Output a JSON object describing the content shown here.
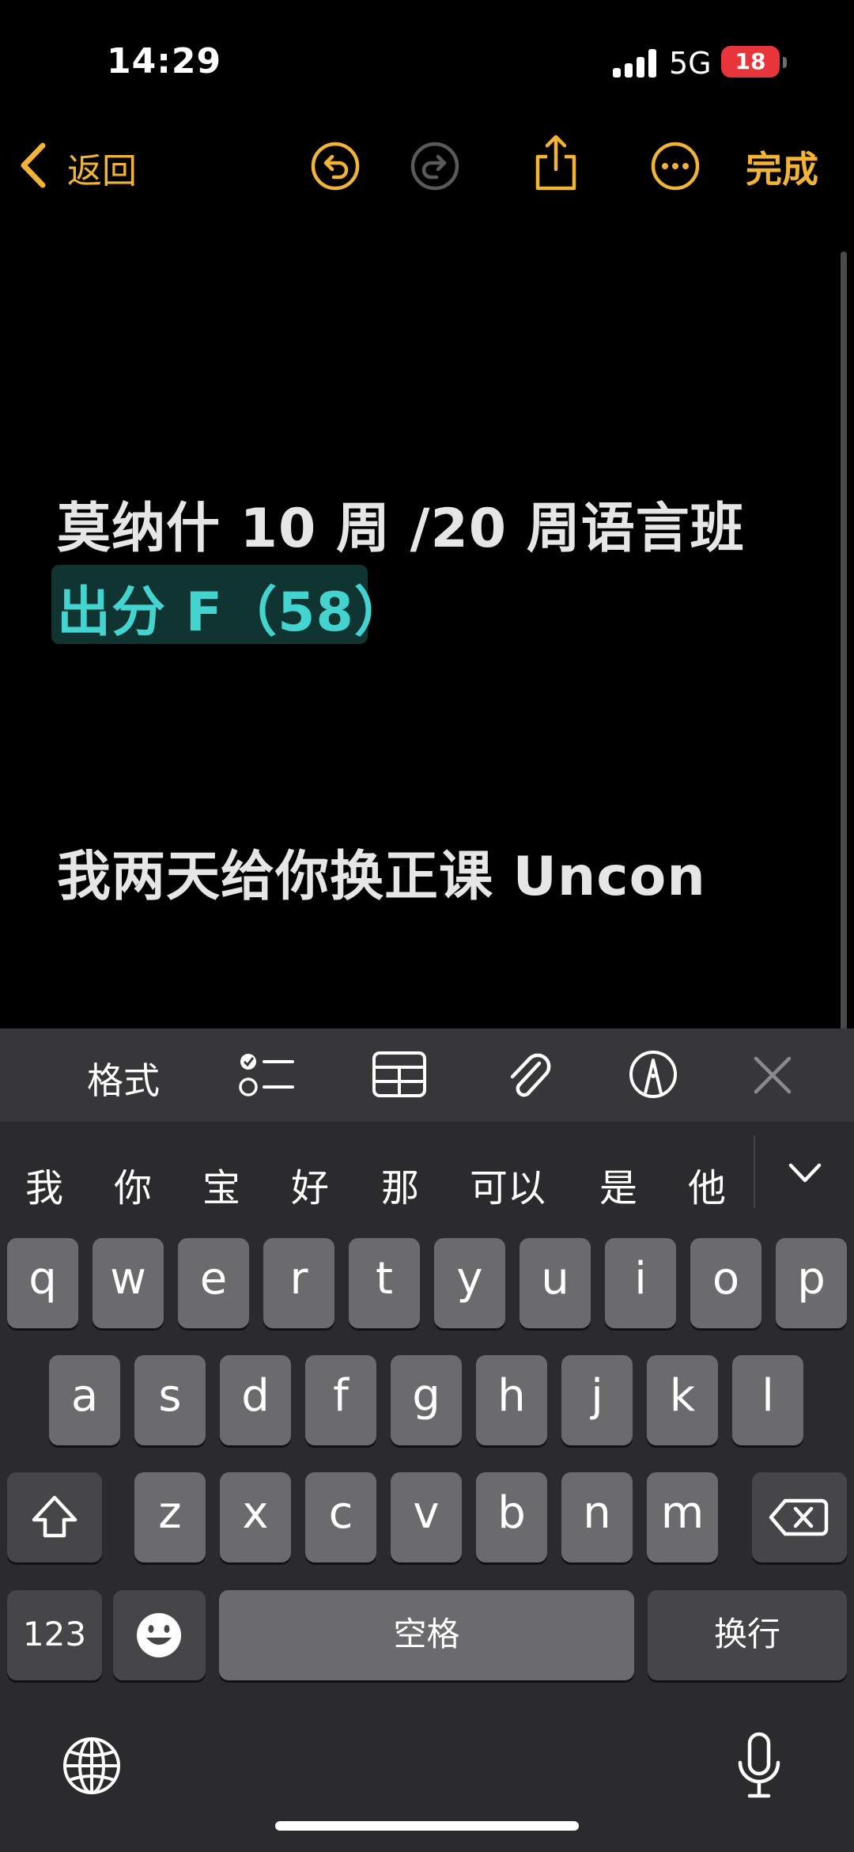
{
  "status_bar": {
    "time": "14:29",
    "network": "5G",
    "battery": "18"
  },
  "nav": {
    "back_label": "返回",
    "done_label": "完成"
  },
  "note": {
    "title": "莫纳什 10 周 /20 周语言班",
    "highlight": "出分 F（58）",
    "body": "我两天给你换正课 Uncon"
  },
  "toolbar": {
    "format_label": "格式"
  },
  "keyboard": {
    "candidates": [
      "我",
      "你",
      "宝",
      "好",
      "那",
      "可以",
      "是",
      "他"
    ],
    "row1": [
      "q",
      "w",
      "e",
      "r",
      "t",
      "y",
      "u",
      "i",
      "o",
      "p"
    ],
    "row2": [
      "a",
      "s",
      "d",
      "f",
      "g",
      "h",
      "j",
      "k",
      "l"
    ],
    "row3": [
      "z",
      "x",
      "c",
      "v",
      "b",
      "n",
      "m"
    ],
    "numbers_label": "123",
    "space_label": "空格",
    "return_label": "换行"
  },
  "colors": {
    "accent": "#f2b437",
    "highlight_text": "#44d4cf",
    "highlight_bg": "#103432",
    "battery_low": "#e8353b"
  }
}
